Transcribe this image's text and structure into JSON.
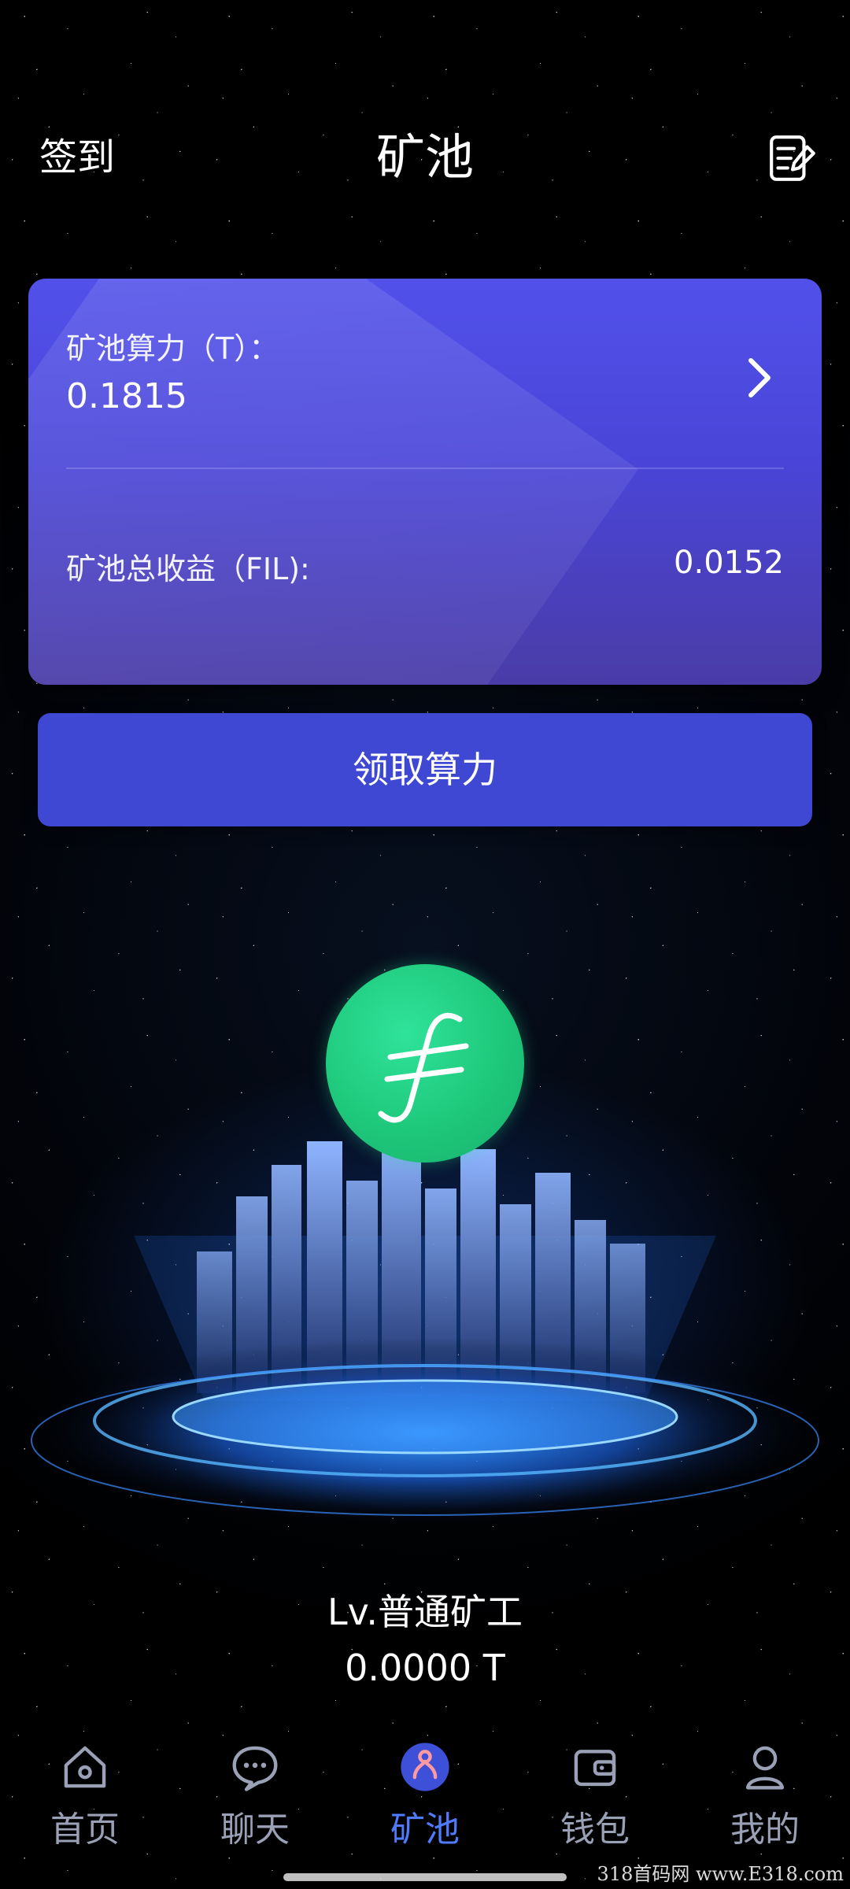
{
  "header": {
    "checkin_label": "签到",
    "title": "矿池",
    "note_icon": "note-icon"
  },
  "card": {
    "hashrate_label": "矿池算力（T）：",
    "hashrate_value": "0.1815",
    "total_income_label": "矿池总收益（FIL):",
    "total_income_value": "0.0152",
    "chevron_icon": "chevron-right-icon"
  },
  "claim_button": {
    "label": "领取算力"
  },
  "coin": {
    "icon": "filecoin-icon",
    "color": "#1ec87b"
  },
  "miner": {
    "level": "Lv.普通矿工",
    "power": "0.0000 T"
  },
  "bottom_nav": {
    "items": [
      {
        "label": "首页",
        "icon": "home-icon",
        "active": false
      },
      {
        "label": "聊天",
        "icon": "chat-icon",
        "active": false
      },
      {
        "label": "矿池",
        "icon": "mining-icon",
        "active": true
      },
      {
        "label": "钱包",
        "icon": "wallet-icon",
        "active": false
      },
      {
        "label": "我的",
        "icon": "profile-icon",
        "active": false
      }
    ]
  },
  "watermark": "318首码网  www.E318.com",
  "colors": {
    "accent": "#4f7cff",
    "card_top": "#5151ea",
    "card_bottom": "#4a3ca7",
    "button": "#3f48d3",
    "nav_inactive": "#9aa0b5"
  }
}
